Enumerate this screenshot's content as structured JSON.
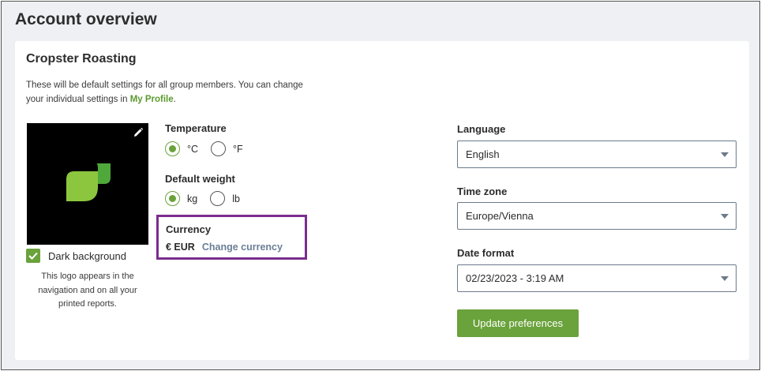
{
  "page": {
    "title": "Account overview"
  },
  "group": {
    "name": "Cropster Roasting",
    "description": "These will be default settings for all group members. You can change your individual settings in ",
    "profile_link": "My Profile",
    "description_end": "."
  },
  "logo": {
    "dark_background_label": "Dark background",
    "dark_background_checked": true,
    "note": "This logo appears in the navigation and on all your printed reports."
  },
  "temperature": {
    "label": "Temperature",
    "options": [
      {
        "label": "°C",
        "checked": true
      },
      {
        "label": "°F",
        "checked": false
      }
    ]
  },
  "weight": {
    "label": "Default weight",
    "options": [
      {
        "label": "kg",
        "checked": true
      },
      {
        "label": "lb",
        "checked": false
      }
    ]
  },
  "currency": {
    "label": "Currency",
    "value": "€ EUR",
    "change_link": "Change currency"
  },
  "language": {
    "label": "Language",
    "value": "English"
  },
  "timezone": {
    "label": "Time zone",
    "value": "Europe/Vienna"
  },
  "date_format": {
    "label": "Date format",
    "value": "02/23/2023 - 3:19 AM"
  },
  "actions": {
    "update_label": "Update preferences"
  },
  "colors": {
    "accent": "#6aa23b",
    "highlight_border": "#7b2d8e",
    "link_muted": "#6a7f96"
  },
  "icons": {
    "edit": "pencil-icon",
    "logo": "leaf-logo",
    "checkbox": "checkmark-icon",
    "dropdown": "chevron-down-icon"
  }
}
